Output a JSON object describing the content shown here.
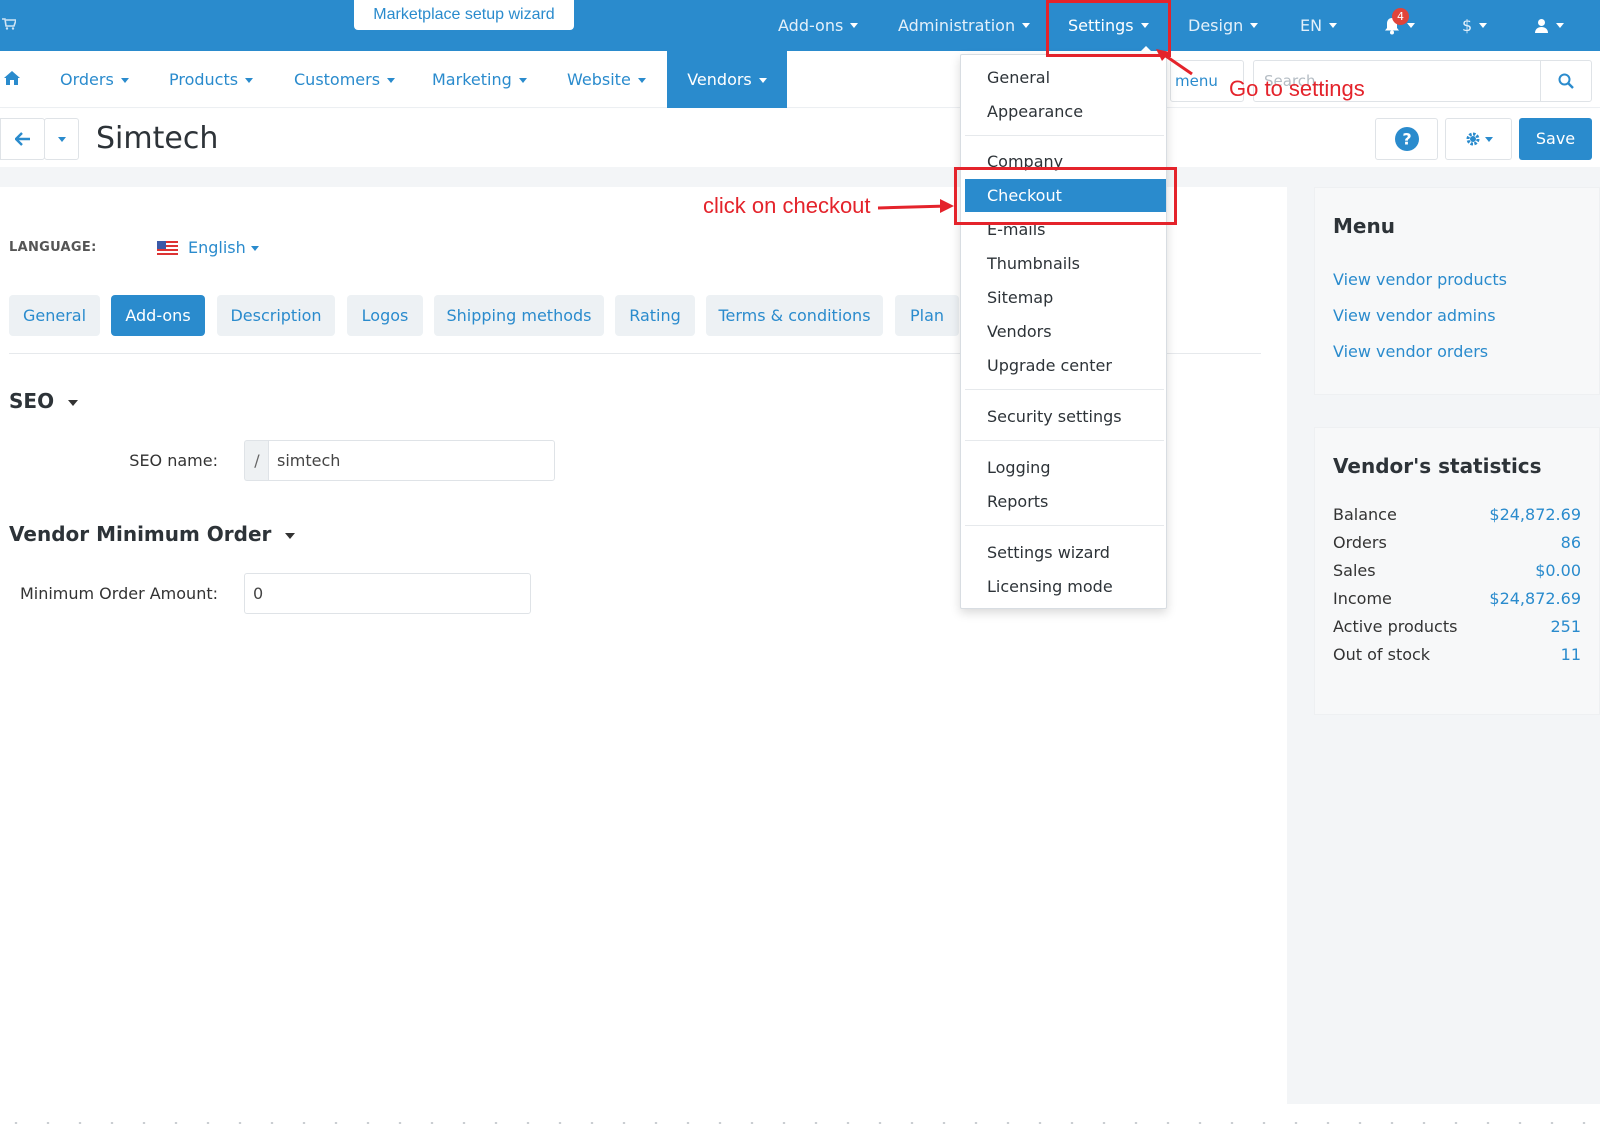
{
  "topbar": {
    "wizard_label": "Marketplace setup wizard",
    "menus": [
      "Add-ons",
      "Administration",
      "Settings",
      "Design",
      "EN",
      "$"
    ],
    "notification_count": "4"
  },
  "subnav": {
    "items": [
      "Orders",
      "Products",
      "Customers",
      "Marketing",
      "Website",
      "Vendors"
    ],
    "menu_label": "menu",
    "search_placeholder": "Search..."
  },
  "titlebar": {
    "title": "Simtech",
    "save_label": "Save"
  },
  "language": {
    "label": "LANGUAGE:",
    "value": "English"
  },
  "tabs": [
    "General",
    "Add-ons",
    "Description",
    "Logos",
    "Shipping methods",
    "Rating",
    "Terms & conditions",
    "Plan"
  ],
  "seo": {
    "title": "SEO",
    "name_label": "SEO name:",
    "prefix": "/",
    "name_value": "simtech"
  },
  "min_order": {
    "title": "Vendor Minimum Order",
    "label": "Minimum Order Amount:",
    "value": "0"
  },
  "settings_menu": {
    "items": [
      "General",
      "Appearance",
      "Company",
      "Checkout",
      "E-mails",
      "Thumbnails",
      "Sitemap",
      "Vendors",
      "Upgrade center",
      "Security settings",
      "Logging",
      "Reports",
      "Settings wizard",
      "Licensing mode"
    ],
    "active": "Checkout"
  },
  "sidebar": {
    "menu_title": "Menu",
    "links": [
      "View vendor products",
      "View vendor admins",
      "View vendor orders"
    ],
    "stats_title": "Vendor's statistics",
    "stats": [
      {
        "label": "Balance",
        "value": "$24,872.69"
      },
      {
        "label": "Orders",
        "value": "86"
      },
      {
        "label": "Sales",
        "value": "$0.00"
      },
      {
        "label": "Income",
        "value": "$24,872.69"
      },
      {
        "label": "Active products",
        "value": "251"
      },
      {
        "label": "Out of stock",
        "value": "11"
      }
    ]
  },
  "annotations": {
    "go_to_settings": "Go to settings",
    "click_checkout": "click on checkout"
  },
  "colors": {
    "primary": "#2a8bcd",
    "annotation": "#e4232b"
  }
}
